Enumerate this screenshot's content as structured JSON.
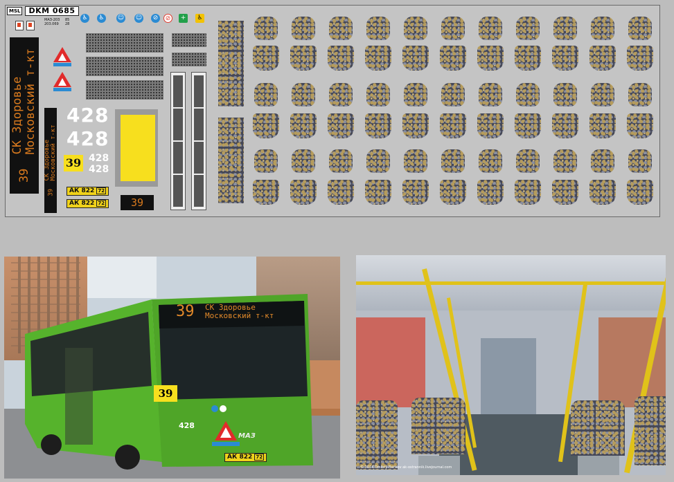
{
  "sheet": {
    "brand_logo": "MSL",
    "code": "DKM 0685",
    "tiny_text_1": "МАЗ-203",
    "tiny_text_2": "203.069",
    "tiny_num_1": "85",
    "tiny_num_2": "28",
    "route_number": "39",
    "route_line1": "СК Здоровье",
    "route_line2": "Московский т-кт",
    "bus_number": "428",
    "plate": "АК 822",
    "plate_region": "72",
    "pictograms": [
      {
        "icon": "wheelchair-icon",
        "color": "#2b8bd3"
      },
      {
        "icon": "wheelchair-icon",
        "color": "#2b8bd3"
      },
      {
        "icon": "person-icon",
        "color": "#2b8bd3"
      },
      {
        "icon": "person-icon",
        "color": "#2b8bd3"
      },
      {
        "icon": "no-smoking-icon",
        "color": "#2b8bd3"
      },
      {
        "icon": "no-smoking-icon",
        "color": "#e03b2e"
      },
      {
        "icon": "first-aid-icon",
        "color": "#22a04a"
      },
      {
        "icon": "wheelchair-icon",
        "color": "#f2c200"
      }
    ],
    "seat_fabric_colors": [
      "#454858",
      "#b69c5c"
    ]
  },
  "photos": {
    "bus_front": {
      "display_route": "39",
      "display_line1": "СК Здоровье",
      "display_line2": "Московский т-кт",
      "windshield_route": "39",
      "side_number": "428",
      "plate": "АК 822",
      "plate_region": "72",
      "brand_badge": "МАЗ"
    },
    "interior": {
      "credit": "© 2014 Dmitriy Borisov  ak-ostrannik.livejournal.com"
    }
  },
  "colors": {
    "bus_green": "#56b32c",
    "sign_orange": "#d97a1e",
    "yellow": "#f7df1e"
  }
}
